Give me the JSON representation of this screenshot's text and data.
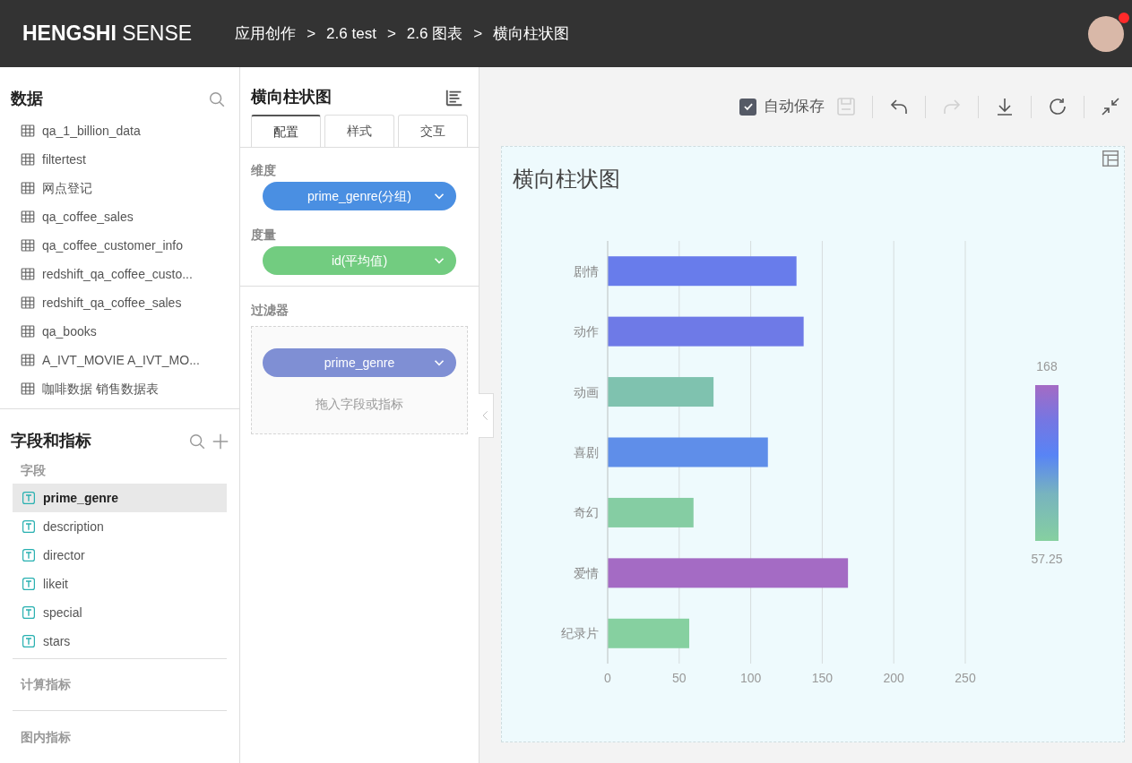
{
  "header": {
    "logo_bold": "HENGSHI",
    "logo_light": "SENSE",
    "breadcrumbs": [
      "应用创作",
      "2.6 test",
      "2.6 图表",
      "横向柱状图"
    ],
    "separator": ">",
    "avatar_badge": true
  },
  "data_panel": {
    "title": "数据",
    "items": [
      {
        "label": "qa_1_billion_data"
      },
      {
        "label": "filtertest"
      },
      {
        "label": "网点登记"
      },
      {
        "label": "qa_coffee_sales"
      },
      {
        "label": "qa_coffee_customer_info"
      },
      {
        "label": "redshift_qa_coffee_custo..."
      },
      {
        "label": "redshift_qa_coffee_sales"
      },
      {
        "label": "qa_books"
      },
      {
        "label": "A_IVT_MOVIE A_IVT_MO..."
      },
      {
        "label": "咖啡数据 销售数据表"
      }
    ]
  },
  "fields_panel": {
    "title": "字段和指标",
    "fields_heading": "字段",
    "fields": [
      {
        "label": "prime_genre",
        "selected": true
      },
      {
        "label": "description",
        "selected": false
      },
      {
        "label": "director",
        "selected": false
      },
      {
        "label": "likeit",
        "selected": false
      },
      {
        "label": "special",
        "selected": false
      },
      {
        "label": "stars",
        "selected": false
      }
    ],
    "sections": [
      "计算指标",
      "图内指标"
    ]
  },
  "config_panel": {
    "title": "横向柱状图",
    "tabs": [
      {
        "label": "配置",
        "selected": true
      },
      {
        "label": "样式",
        "selected": false
      },
      {
        "label": "交互",
        "selected": false
      }
    ],
    "groups": [
      {
        "label": "维度",
        "pill": {
          "text": "prime_genre(分组)",
          "kind": "dimension"
        }
      },
      {
        "label": "度量",
        "pill": {
          "text": "id(平均值)",
          "kind": "measure"
        }
      }
    ],
    "filter": {
      "label": "过滤器",
      "pill": {
        "text": "prime_genre",
        "kind": "filter"
      },
      "hint": "拖入字段或指标"
    }
  },
  "toolbar": {
    "autosave": {
      "label": "自动保存",
      "checked": true
    },
    "buttons": [
      {
        "kind": "save",
        "disabled": true
      },
      {
        "kind": "undo",
        "disabled": false
      },
      {
        "kind": "redo",
        "disabled": true
      },
      {
        "kind": "download",
        "disabled": false
      },
      {
        "kind": "refresh",
        "disabled": false
      },
      {
        "kind": "collapse",
        "disabled": false
      }
    ]
  },
  "chart": {
    "title": "横向柱状图",
    "legend": {
      "max": "168",
      "min": "57.25"
    },
    "chart_data": {
      "type": "bar",
      "orientation": "horizontal",
      "categories": [
        "剧情",
        "动作",
        "动画",
        "喜剧",
        "奇幻",
        "爱情",
        "纪录片"
      ],
      "series": [
        {
          "values": [
            132,
            137,
            74,
            112,
            60,
            168,
            57
          ]
        }
      ],
      "grid": true,
      "xlim": [
        0,
        250
      ],
      "xticks": [
        0,
        50,
        100,
        150,
        200,
        250
      ]
    }
  }
}
